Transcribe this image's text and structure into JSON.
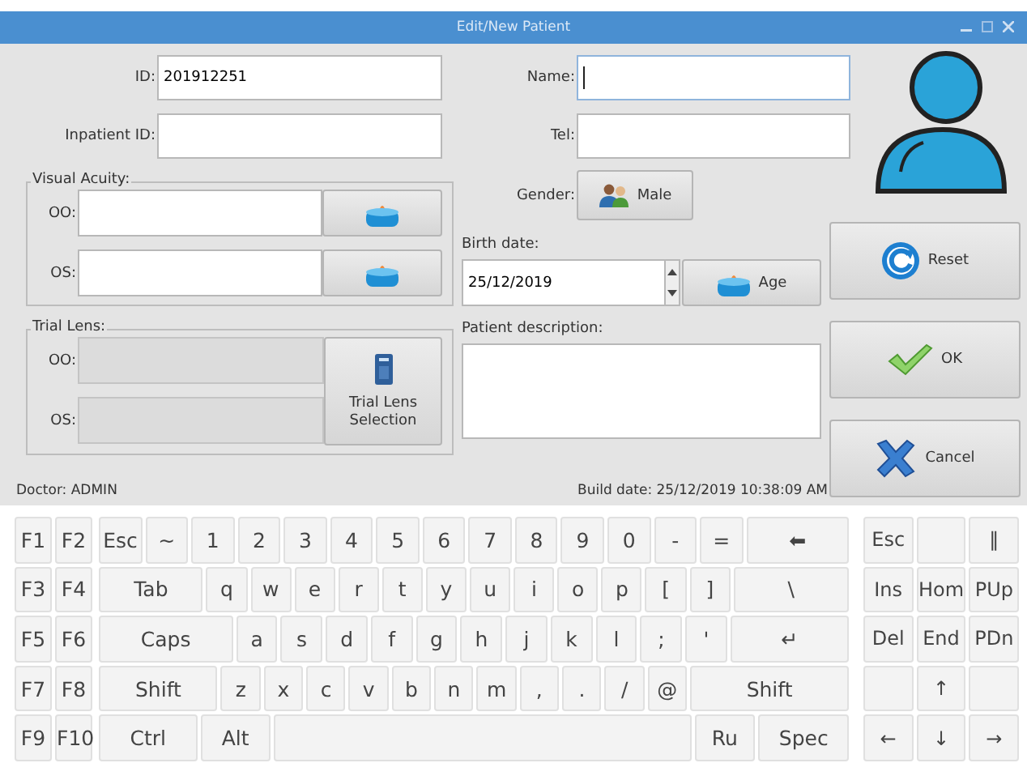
{
  "window": {
    "title": "Edit/New Patient"
  },
  "fields": {
    "id": {
      "label": "ID:",
      "value": "201912251"
    },
    "inpatient_id": {
      "label": "Inpatient ID:"
    },
    "name": {
      "label": "Name:",
      "focused": true
    },
    "tel": {
      "label": "Tel:"
    }
  },
  "gender": {
    "label": "Gender:",
    "button": "Male"
  },
  "visual_acuity": {
    "title": "Visual Acuity:",
    "rows": [
      {
        "label": "OO:"
      },
      {
        "label": "OS:"
      }
    ]
  },
  "trial_lens": {
    "title": "Trial Lens:",
    "rows": [
      {
        "label": "OO:",
        "disabled": true
      },
      {
        "label": "OS:",
        "disabled": true
      }
    ],
    "button": "Trial Lens Selection"
  },
  "birth_date": {
    "label": "Birth date:",
    "value": "25/12/2019",
    "age_button": "Age"
  },
  "description": {
    "label": "Patient description:"
  },
  "actions": [
    {
      "kind": "reset",
      "label": "Reset"
    },
    {
      "kind": "ok",
      "label": "OK"
    },
    {
      "kind": "cancel",
      "label": "Cancel"
    }
  ],
  "footer": {
    "doctor": "Doctor: ADMIN",
    "build_date": "Build date: 25/12/2019 10:38:09 AM"
  },
  "keyboard": {
    "rows": [
      {
        "fkeys": [
          "F1",
          "F2"
        ],
        "keys": [
          "Esc",
          "~",
          "1",
          "2",
          "3",
          "4",
          "5",
          "6",
          "7",
          "8",
          "9",
          "0",
          "-",
          "=",
          "⬅"
        ],
        "nav": [
          "Esc",
          {
            "kind": "blank"
          },
          "‖"
        ]
      },
      {
        "fkeys": [
          "F3",
          "F4"
        ],
        "keys": [
          "Tab",
          "q",
          "w",
          "e",
          "r",
          "t",
          "y",
          "u",
          "i",
          "o",
          "p",
          "[",
          "]",
          "\\"
        ],
        "nav": [
          "Ins",
          "Hom",
          "PUp"
        ]
      },
      {
        "fkeys": [
          "F5",
          "F6"
        ],
        "keys": [
          "Caps",
          "a",
          "s",
          "d",
          "f",
          "g",
          "h",
          "j",
          "k",
          "l",
          ";",
          "'",
          "↵"
        ],
        "nav": [
          "Del",
          "End",
          "PDn"
        ]
      },
      {
        "fkeys": [
          "F7",
          "F8"
        ],
        "keys": [
          "Shift",
          "z",
          "x",
          "c",
          "v",
          "b",
          "n",
          "m",
          ",",
          ".",
          "/",
          "@",
          "Shift"
        ],
        "nav": [
          {
            "kind": "blank"
          },
          "↑",
          {
            "kind": "blank"
          }
        ]
      },
      {
        "fkeys": [
          "F9",
          "F10"
        ],
        "keys": [
          "Ctrl",
          "Alt",
          {
            "kind": "blank"
          },
          "Ru",
          "Spec"
        ],
        "nav": [
          "←",
          "↓",
          "→"
        ]
      }
    ]
  }
}
